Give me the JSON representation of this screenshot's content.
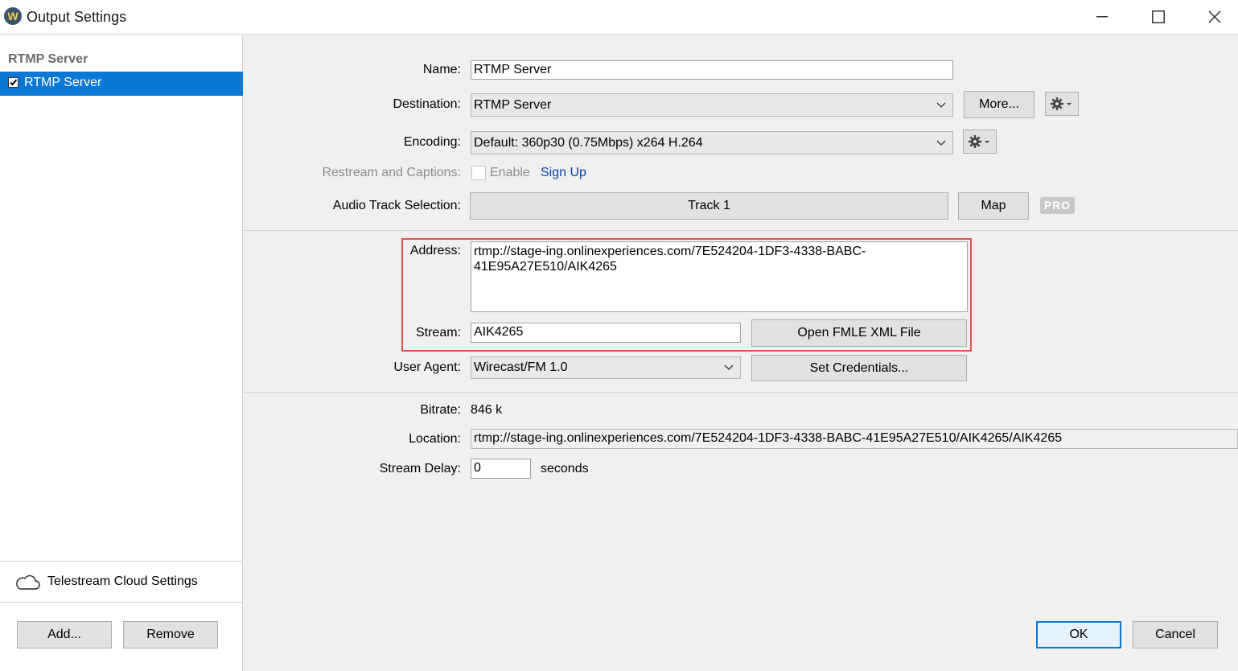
{
  "window": {
    "title": "Output Settings",
    "app_icon_letter": "W"
  },
  "sidebar": {
    "header": "RTMP Server",
    "items": [
      {
        "label": "RTMP Server",
        "checked": true,
        "selected": true
      }
    ],
    "cloud_settings_label": "Telestream Cloud Settings",
    "add_label": "Add...",
    "remove_label": "Remove"
  },
  "form": {
    "name_label": "Name:",
    "name_value": "RTMP Server",
    "destination_label": "Destination:",
    "destination_value": "RTMP Server",
    "more_label": "More...",
    "encoding_label": "Encoding:",
    "encoding_value": "Default: 360p30 (0.75Mbps) x264 H.264",
    "restream_label": "Restream and Captions:",
    "enable_label": "Enable",
    "signup_label": "Sign Up",
    "audio_label": "Audio Track Selection:",
    "audio_value": "Track 1",
    "map_label": "Map",
    "pro_badge": "PRO",
    "address_label": "Address:",
    "address_value_line1": "rtmp://stage-ing.onlinexperiences.com/7E524204-1DF3-4338-BABC-",
    "address_value_line2": "41E95A27E510/AIK4265",
    "stream_label": "Stream:",
    "stream_value": "AIK4265",
    "open_fmle_label": "Open FMLE XML File",
    "user_agent_label": "User Agent:",
    "user_agent_value": "Wirecast/FM 1.0",
    "set_credentials_label": "Set Credentials...",
    "bitrate_label": "Bitrate:",
    "bitrate_value": "846 k",
    "location_label": "Location:",
    "location_value": "rtmp://stage-ing.onlinexperiences.com/7E524204-1DF3-4338-BABC-41E95A27E510/AIK4265/AIK4265",
    "stream_delay_label": "Stream Delay:",
    "stream_delay_value": "0",
    "seconds_label": "seconds"
  },
  "footer": {
    "ok_label": "OK",
    "cancel_label": "Cancel"
  },
  "colors": {
    "selection": "#0c78d6",
    "highlight_border": "#e0524d",
    "link": "#0645ad"
  }
}
